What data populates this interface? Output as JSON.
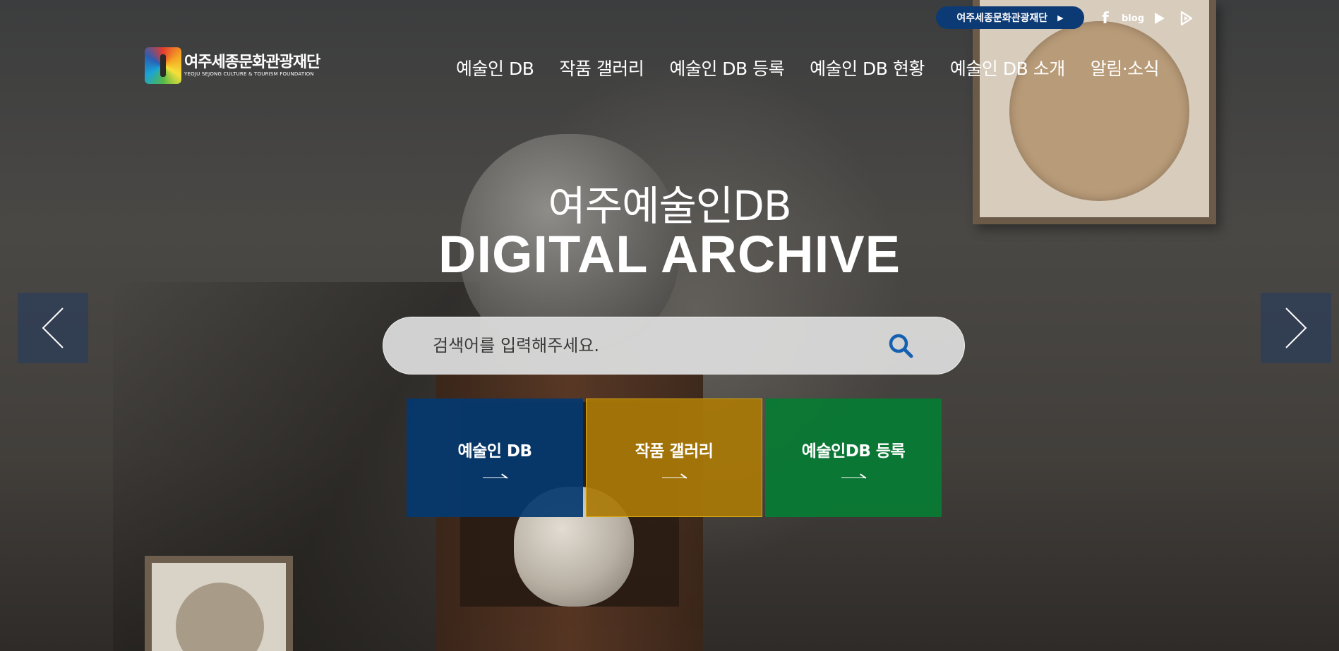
{
  "util": {
    "foundation_link": "여주세종문화관광재단",
    "blog_label": "blog"
  },
  "icons": {
    "facebook": "facebook-icon",
    "blog": "blog-icon",
    "youtube": "youtube-icon",
    "play": "play-store-icon",
    "search": "search-icon",
    "prev": "chevron-left-icon",
    "next": "chevron-right-icon"
  },
  "logo": {
    "name": "여주세종문화관광재단",
    "english": "YEOJU SEJONG CULTURE & TOURISM FOUNDATION"
  },
  "nav": {
    "items": [
      {
        "label": "예술인 DB"
      },
      {
        "label": "작품 갤러리"
      },
      {
        "label": "예술인 DB 등록"
      },
      {
        "label": "예술인 DB 현황"
      },
      {
        "label": "예술인 DB 소개"
      },
      {
        "label": "알림·소식"
      }
    ]
  },
  "hero": {
    "subtitle": "여주예술인DB",
    "title": "DIGITAL ARCHIVE"
  },
  "search": {
    "placeholder": "검색어를 입력해주세요.",
    "value": ""
  },
  "tiles": [
    {
      "label": "예술인 DB",
      "color": "#043870"
    },
    {
      "label": "작품 갤러리",
      "color": "#aa7a06"
    },
    {
      "label": "예술인DB 등록",
      "color": "#087a34"
    }
  ],
  "colors": {
    "pill": "#0b3a75",
    "search_icon": "#1560b0"
  }
}
